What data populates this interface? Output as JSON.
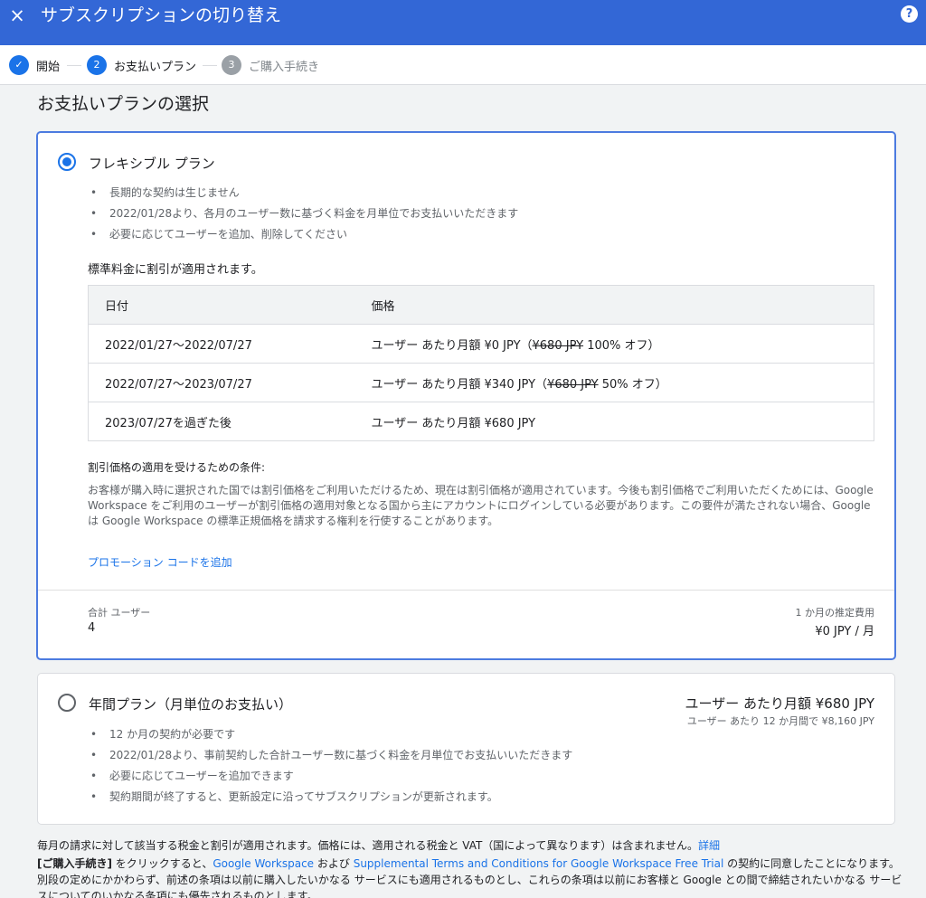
{
  "header": {
    "close_icon": "×",
    "title": "サブスクリプションの切り替え",
    "help_icon": "?"
  },
  "stepper": {
    "steps": [
      {
        "number": "✓",
        "label": "開始",
        "state": "done"
      },
      {
        "number": "2",
        "label": "お支払いプラン",
        "state": "active"
      },
      {
        "number": "3",
        "label": "ご購入手続き",
        "state": "pending"
      }
    ]
  },
  "page_title": "お支払いプランの選択",
  "flexible_plan": {
    "selected": true,
    "title": "フレキシブル プラン",
    "bullets": [
      "長期的な契約は生じません",
      "2022/01/28より、各月のユーザー数に基づく料金を月単位でお支払いいただきます",
      "必要に応じてユーザーを追加、削除してください"
    ],
    "discount_note": "標準料金に割引が適用されます。",
    "table": {
      "headers": [
        "日付",
        "価格"
      ],
      "rows": [
        {
          "date": "2022/01/27〜2022/07/27",
          "price_prefix": "ユーザー あたり月額 ¥0 JPY（",
          "price_struck": "¥680 JPY",
          "price_suffix": " 100% オフ）"
        },
        {
          "date": "2022/07/27〜2023/07/27",
          "price_prefix": "ユーザー あたり月額 ¥340 JPY（",
          "price_struck": "¥680 JPY",
          "price_suffix": " 50% オフ）"
        },
        {
          "date": "2023/07/27を過ぎた後",
          "price_prefix": "ユーザー あたり月額 ¥680 JPY",
          "price_struck": "",
          "price_suffix": ""
        }
      ]
    },
    "conditions_title": "割引価格の適用を受けるための条件:",
    "conditions_body": "お客様が購入時に選択された国では割引価格をご利用いただけるため、現在は割引価格が適用されています。今後も割引価格でご利用いただくためには、Google Workspace をご利用のユーザーが割引価格の適用対象となる国から主にアカウントにログインしている必要があります。この要件が満たされない場合、Google は Google Workspace の標準正規価格を請求する権利を行使することがあります。",
    "promo_link": "プロモーション コードを追加",
    "total_users_label": "合計 ユーザー",
    "total_users_value": "4",
    "estimated_cost_label": "1 か月の推定費用",
    "estimated_cost_value": "¥0 JPY / 月"
  },
  "annual_plan": {
    "selected": false,
    "title": "年間プラン（月単位のお支払い）",
    "price": "ユーザー あたり月額 ¥680 JPY",
    "price_sub": "ユーザー あたり 12 か月間で ¥8,160 JPY",
    "bullets": [
      "12 か月の契約が必要です",
      "2022/01/28より、事前契約した合計ユーザー数に基づく料金を月単位でお支払いいただきます",
      "必要に応じてユーザーを追加できます",
      "契約期間が終了すると、更新設定に沿ってサブスクリプションが更新されます。"
    ]
  },
  "footer": {
    "tax_note": "毎月の請求に対して該当する税金と割引が適用されます。価格には、適用される税金と VAT（国によって異なります）は含まれません。",
    "details_link": "詳細",
    "terms_bold": "[ご購入手続き]",
    "terms_part1": " をクリックすると、",
    "terms_link1": "Google Workspace",
    "terms_part2": " および ",
    "terms_link2": "Supplemental Terms and Conditions for Google Workspace Free Trial",
    "terms_part3": " の契約に同意したことになります。 別段の定めにかかわらず、前述の条項は以前に購入したいかなる サービスにも適用されるものとし、これらの条項は以前にお客様と Google との間で締結されたいかなる サービスについてのいかなる条項にも優先されるものとします。"
  },
  "colors": {
    "header_bg": "#3367d6",
    "accent": "#1a73e8",
    "page_bg": "#f1f3f4"
  }
}
